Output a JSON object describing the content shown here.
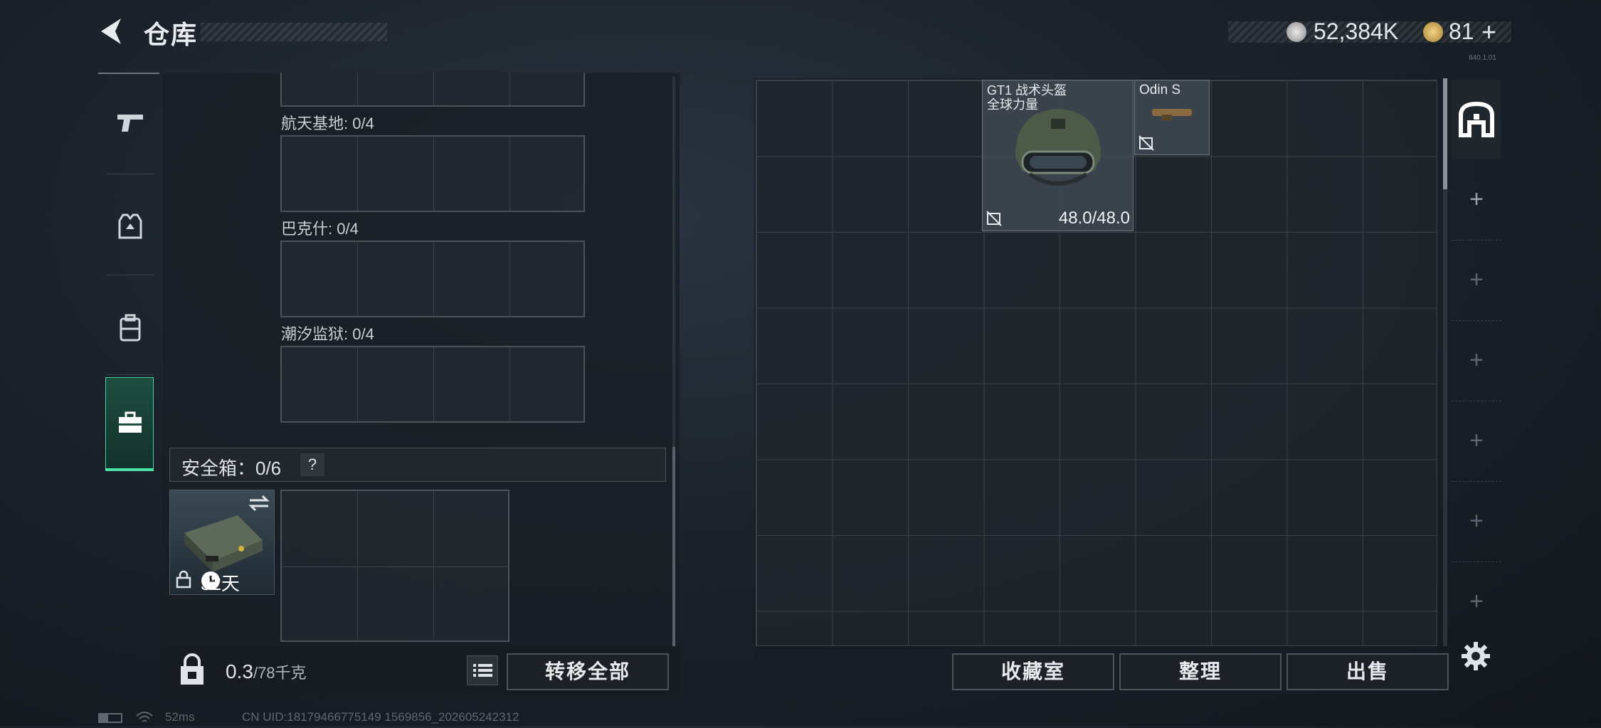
{
  "header": {
    "title": "仓库",
    "currency_silver": "52,384K",
    "currency_gold": "81",
    "currency_gold_add": "+",
    "version": "840.1.01"
  },
  "left_nav": {
    "items": [
      {
        "icon": "pistol-icon"
      },
      {
        "icon": "armor-vest-icon"
      },
      {
        "icon": "backpack-icon"
      },
      {
        "icon": "toolbox-icon",
        "active": true
      }
    ]
  },
  "collections": [
    {
      "label": "航天基地: 0/4"
    },
    {
      "label": "巴克什: 0/4"
    },
    {
      "label": "潮汐监狱: 0/4"
    }
  ],
  "safe_box": {
    "label": "安全箱：0/6",
    "help": "?",
    "duration": "32天"
  },
  "weight": {
    "current": "0.3",
    "max": "/78千克"
  },
  "buttons": {
    "transfer_all": "转移全部",
    "collection_room": "收藏室",
    "organize": "整理",
    "sell": "出售"
  },
  "items": {
    "helmet": {
      "name_line1": "GT1 战术头盔",
      "name_line2": "全球力量",
      "durability": "48.0/48.0"
    },
    "odin": {
      "name": "Odin S"
    }
  },
  "right_sidebar": {
    "slots": [
      "+",
      "+",
      "+",
      "+",
      "+",
      "+"
    ]
  },
  "footer": {
    "ping": "52ms",
    "uid": "CN UID:18179466775149 1569856_202605242312"
  }
}
